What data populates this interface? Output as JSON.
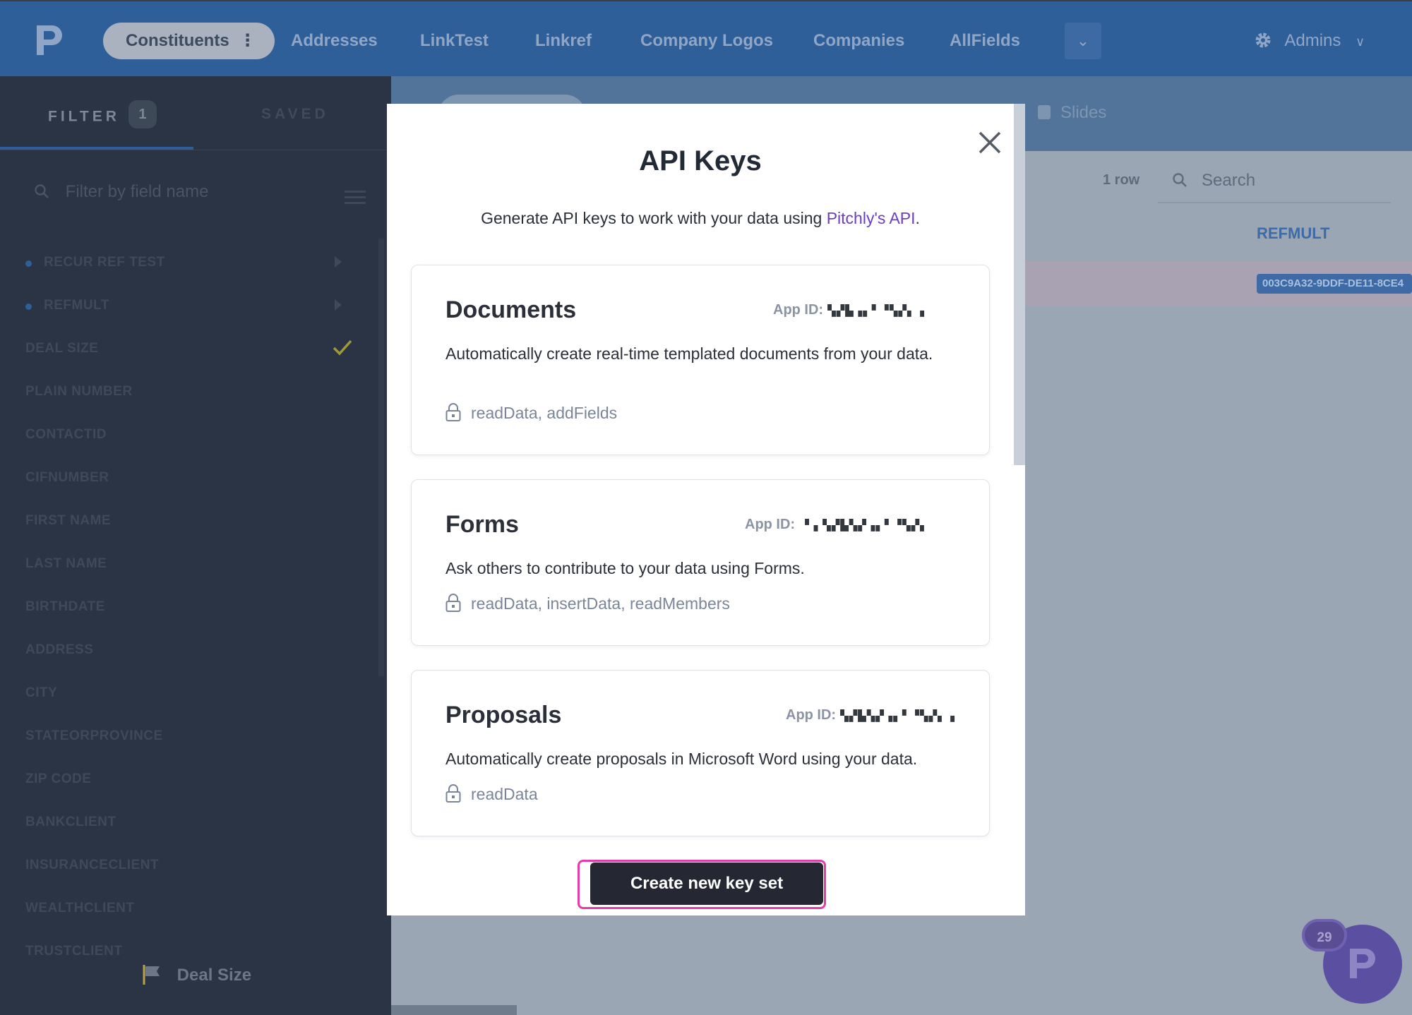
{
  "nav": {
    "tabs": [
      {
        "label": "Constituents",
        "active": true
      },
      {
        "label": "Addresses"
      },
      {
        "label": "LinkTest"
      },
      {
        "label": "Linkref"
      },
      {
        "label": "Company Logos"
      },
      {
        "label": "Companies"
      },
      {
        "label": "AllFields"
      }
    ],
    "more_icon": "chevron-down-icon",
    "account": {
      "label": "Admins",
      "icon": "gear-icon"
    },
    "colors": {
      "bar": "#2f5f99",
      "active_tab_bg": "#a9b2be"
    }
  },
  "sidebar": {
    "tabs": {
      "filter": "FILTER",
      "filter_count": "1",
      "saved": "SAVED"
    },
    "search_placeholder": "Filter by field name",
    "fields": [
      {
        "label": "RECUR REF TEST",
        "dot": true,
        "arrow": true
      },
      {
        "label": "REFMULT",
        "dot": true,
        "arrow": true
      },
      {
        "label": "DEAL SIZE",
        "checked": true
      },
      {
        "label": "PLAIN NUMBER"
      },
      {
        "label": "CONTACTID"
      },
      {
        "label": "CIFNUMBER"
      },
      {
        "label": "FIRST NAME"
      },
      {
        "label": "LAST NAME"
      },
      {
        "label": "BIRTHDATE"
      },
      {
        "label": "ADDRESS"
      },
      {
        "label": "CITY"
      },
      {
        "label": "STATEORPROVINCE"
      },
      {
        "label": "ZIP CODE"
      },
      {
        "label": "BANKCLIENT"
      },
      {
        "label": "INSURANCECLIENT"
      },
      {
        "label": "WEALTHCLIENT"
      },
      {
        "label": "TRUSTCLIENT"
      }
    ],
    "footer": {
      "label": "Deal Size",
      "icon": "flag-icon"
    }
  },
  "main": {
    "slides_label": "Slides",
    "row_count": "1 row",
    "search_placeholder": "Search",
    "column_header": "REFMULT",
    "cell_tag": "003C9A32-9DDF-DE11-8CE4",
    "notification_count": "29"
  },
  "modal": {
    "title": "API Keys",
    "subtitle_prefix": "Generate API keys to work with your data using ",
    "subtitle_link": "Pitchly's API",
    "subtitle_suffix": ".",
    "cards": [
      {
        "title": "Documents",
        "app_id_label": "App ID:",
        "app_id_value": "▚▞▙▗▖▘▝▚▞▖▗",
        "description": "Automatically create real-time templated documents from your data.",
        "permissions": "readData, addFields"
      },
      {
        "title": "Forms",
        "app_id_label": "App ID:",
        "app_id_value": "▘▖▚▞▙▚▞▗▖▘▝▚▞▖",
        "description": "Ask others to contribute to your data using Forms.",
        "permissions": "readData, insertData, readMembers"
      },
      {
        "title": "Proposals",
        "app_id_label": "App ID:",
        "app_id_value": "▚▞▙▚▞▗▖▘▝▚▞▖▗",
        "description": "Automatically create proposals in Microsoft Word using your data.",
        "permissions": "readData"
      }
    ],
    "create_button": "Create new key set",
    "colors": {
      "link": "#6b3fc4",
      "button_bg": "#252832",
      "focus_ring": "#e53ca8"
    }
  }
}
